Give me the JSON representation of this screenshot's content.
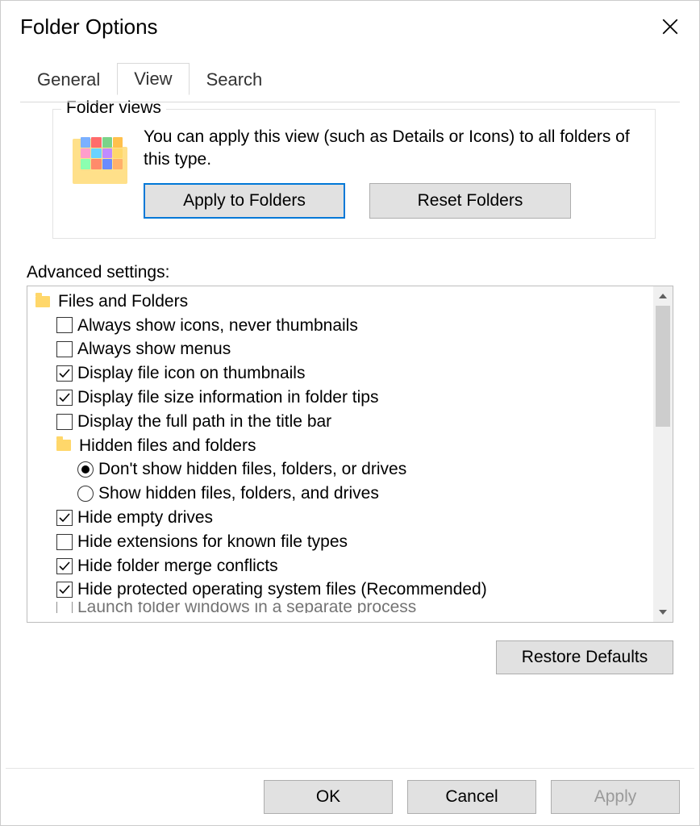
{
  "window": {
    "title": "Folder Options"
  },
  "tabs": {
    "general": "General",
    "view": "View",
    "search": "Search",
    "active": "view"
  },
  "folderViews": {
    "groupLabel": "Folder views",
    "description": "You can apply this view (such as Details or Icons) to all folders of this type.",
    "applyButton": "Apply to Folders",
    "resetButton": "Reset Folders"
  },
  "advanced": {
    "label": "Advanced settings:",
    "header": "Files and Folders",
    "items": [
      {
        "type": "checkbox",
        "checked": false,
        "label": "Always show icons, never thumbnails"
      },
      {
        "type": "checkbox",
        "checked": false,
        "label": "Always show menus"
      },
      {
        "type": "checkbox",
        "checked": true,
        "label": "Display file icon on thumbnails"
      },
      {
        "type": "checkbox",
        "checked": true,
        "label": "Display file size information in folder tips"
      },
      {
        "type": "checkbox",
        "checked": false,
        "label": "Display the full path in the title bar"
      }
    ],
    "hiddenGroup": {
      "label": "Hidden files and folders",
      "options": [
        {
          "checked": true,
          "label": "Don't show hidden files, folders, or drives"
        },
        {
          "checked": false,
          "label": "Show hidden files, folders, and drives"
        }
      ]
    },
    "items2": [
      {
        "type": "checkbox",
        "checked": true,
        "label": "Hide empty drives"
      },
      {
        "type": "checkbox",
        "checked": false,
        "label": "Hide extensions for known file types"
      },
      {
        "type": "checkbox",
        "checked": true,
        "label": "Hide folder merge conflicts"
      },
      {
        "type": "checkbox",
        "checked": true,
        "label": "Hide protected operating system files (Recommended)"
      }
    ],
    "cutoff": {
      "type": "checkbox",
      "checked": false,
      "label": "Launch folder windows in a separate process"
    },
    "restoreButton": "Restore Defaults"
  },
  "footer": {
    "ok": "OK",
    "cancel": "Cancel",
    "apply": "Apply"
  }
}
